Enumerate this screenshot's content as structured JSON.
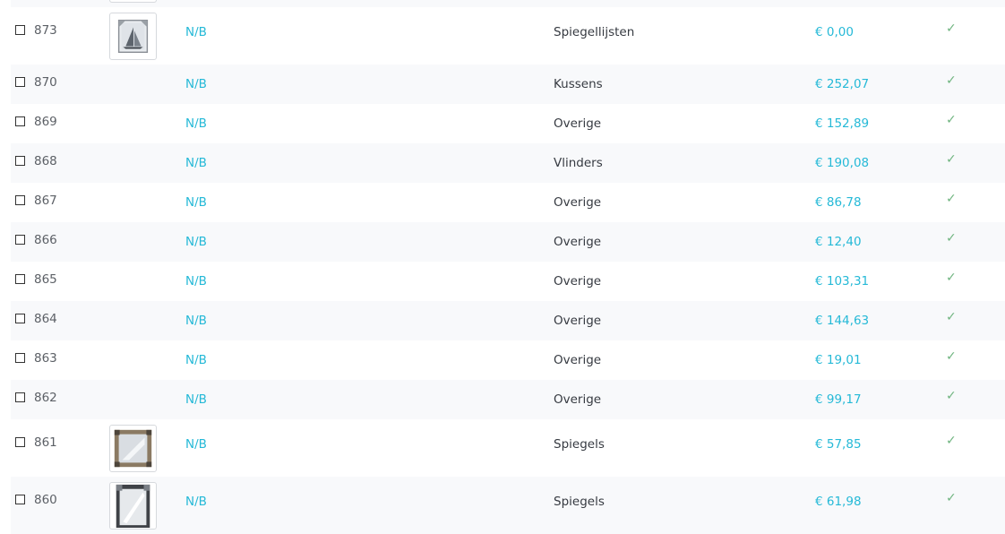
{
  "products": [
    {
      "id": "873",
      "has_image": true,
      "image_icon": "framed-boat-picture-icon",
      "reference": "N/B",
      "category": "Spiegellijsten",
      "price": "€ 0,00",
      "status_icon": "checkmark-icon"
    },
    {
      "id": "870",
      "has_image": false,
      "reference": "N/B",
      "category": "Kussens",
      "price": "€ 252,07",
      "status_icon": "checkmark-icon"
    },
    {
      "id": "869",
      "has_image": false,
      "reference": "N/B",
      "category": "Overige",
      "price": "€ 152,89",
      "status_icon": "checkmark-icon"
    },
    {
      "id": "868",
      "has_image": false,
      "reference": "N/B",
      "category": "Vlinders",
      "price": "€ 190,08",
      "status_icon": "checkmark-icon"
    },
    {
      "id": "867",
      "has_image": false,
      "reference": "N/B",
      "category": "Overige",
      "price": "€ 86,78",
      "status_icon": "checkmark-icon"
    },
    {
      "id": "866",
      "has_image": false,
      "reference": "N/B",
      "category": "Overige",
      "price": "€ 12,40",
      "status_icon": "checkmark-icon"
    },
    {
      "id": "865",
      "has_image": false,
      "reference": "N/B",
      "category": "Overige",
      "price": "€ 103,31",
      "status_icon": "checkmark-icon"
    },
    {
      "id": "864",
      "has_image": false,
      "reference": "N/B",
      "category": "Overige",
      "price": "€ 144,63",
      "status_icon": "checkmark-icon"
    },
    {
      "id": "863",
      "has_image": false,
      "reference": "N/B",
      "category": "Overige",
      "price": "€ 19,01",
      "status_icon": "checkmark-icon"
    },
    {
      "id": "862",
      "has_image": false,
      "reference": "N/B",
      "category": "Overige",
      "price": "€ 99,17",
      "status_icon": "checkmark-icon"
    },
    {
      "id": "861",
      "has_image": true,
      "image_icon": "square-mirror-icon",
      "reference": "N/B",
      "category": "Spiegels",
      "price": "€ 57,85",
      "status_icon": "checkmark-icon"
    },
    {
      "id": "860",
      "has_image": true,
      "image_icon": "ornate-mirror-icon",
      "reference": "N/B",
      "category": "Spiegels",
      "price": "€ 61,98",
      "status_icon": "checkmark-icon"
    }
  ],
  "status_glyph": "✓",
  "colors": {
    "link": "#25b9d7",
    "status_ok": "#70b580",
    "row_alt": "#f8f9fb",
    "text": "#363a41"
  }
}
